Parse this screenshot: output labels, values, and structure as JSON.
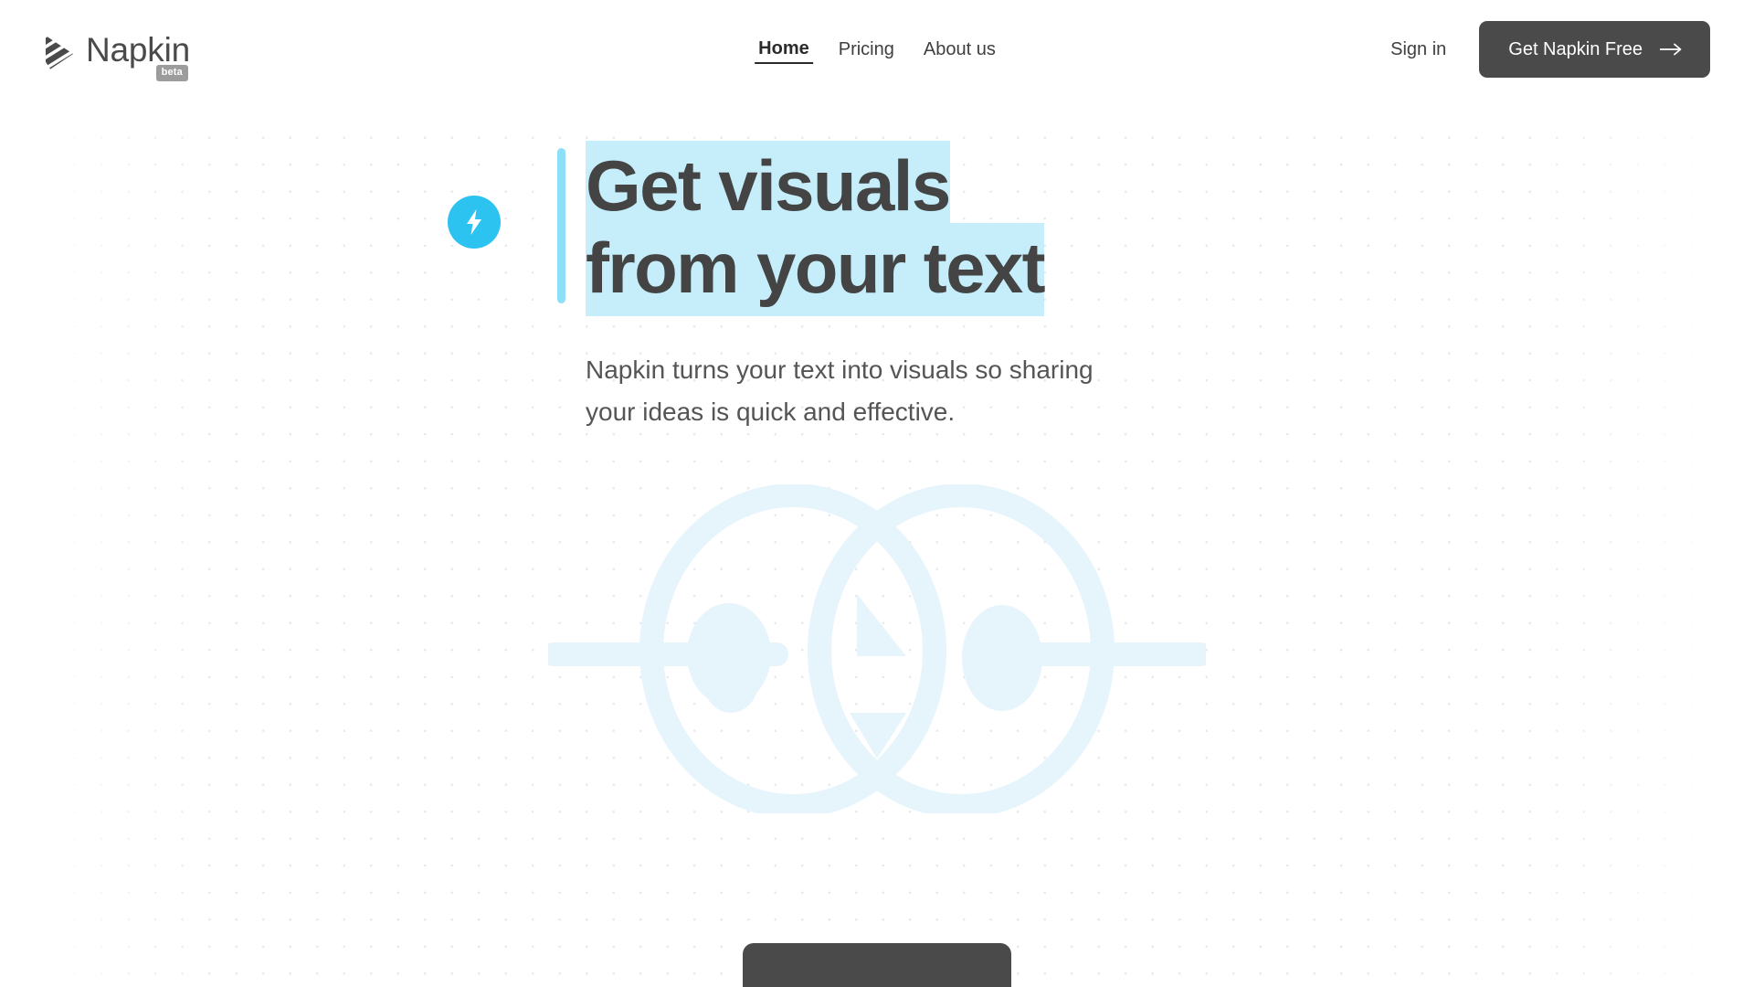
{
  "header": {
    "brand": {
      "name": "Napkin",
      "badge": "beta",
      "logo_icon": "napkin-striped-arrow-logo"
    },
    "nav": [
      {
        "label": "Home",
        "active": true
      },
      {
        "label": "Pricing",
        "active": false
      },
      {
        "label": "About us",
        "active": false
      }
    ],
    "sign_in_label": "Sign in",
    "cta_label": "Get Napkin Free",
    "cta_icon": "arrow-right-icon"
  },
  "hero": {
    "badge_icon": "lightning-bolt-icon",
    "headline_line1": "Get visuals",
    "headline_line2": "from your text",
    "subheadline": "Napkin turns your text into visuals so sharing your ideas is quick and effective."
  },
  "colors": {
    "accent_cyan": "#2dc3f0",
    "accent_bar": "#8de0f7",
    "highlight": "#c5eefa",
    "dark": "#4a4a4a",
    "text": "#444444",
    "muted_text": "#555555",
    "badge_gray": "#9c9c9c",
    "watermark": "#e6f4fb",
    "dot_grid": "#d9dadd"
  }
}
